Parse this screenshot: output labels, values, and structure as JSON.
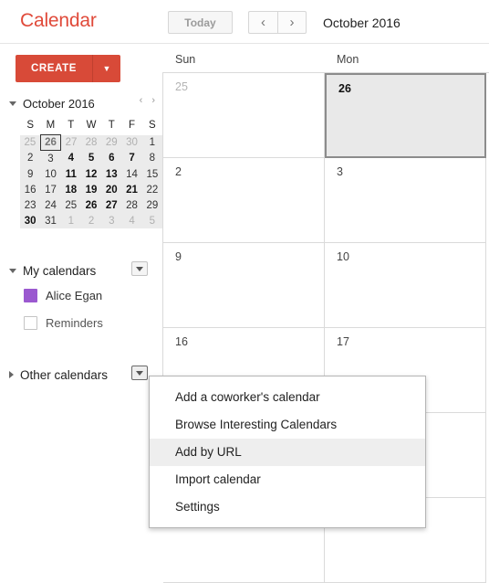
{
  "header": {
    "logo": "Calendar",
    "today_label": "Today",
    "prev_icon": "‹",
    "next_icon": "›",
    "range_title": "October 2016"
  },
  "sidebar": {
    "create_label": "CREATE",
    "create_caret": "▼",
    "mini_calendar": {
      "title": "October 2016",
      "prev_icon": "‹",
      "next_icon": "›",
      "weekdays": [
        "S",
        "M",
        "T",
        "W",
        "T",
        "F",
        "S"
      ],
      "weeks": [
        [
          {
            "d": "25",
            "style": "muted"
          },
          {
            "d": "26",
            "style": "today"
          },
          {
            "d": "27",
            "style": "muted"
          },
          {
            "d": "28",
            "style": "muted"
          },
          {
            "d": "29",
            "style": "muted"
          },
          {
            "d": "30",
            "style": "muted"
          },
          {
            "d": "1",
            "style": "normal"
          }
        ],
        [
          {
            "d": "2",
            "style": "normal"
          },
          {
            "d": "3",
            "style": "normal"
          },
          {
            "d": "4",
            "style": "bold"
          },
          {
            "d": "5",
            "style": "bold"
          },
          {
            "d": "6",
            "style": "bold"
          },
          {
            "d": "7",
            "style": "bold"
          },
          {
            "d": "8",
            "style": "normal"
          }
        ],
        [
          {
            "d": "9",
            "style": "normal"
          },
          {
            "d": "10",
            "style": "normal"
          },
          {
            "d": "11",
            "style": "bold"
          },
          {
            "d": "12",
            "style": "bold"
          },
          {
            "d": "13",
            "style": "bold"
          },
          {
            "d": "14",
            "style": "normal"
          },
          {
            "d": "15",
            "style": "normal"
          }
        ],
        [
          {
            "d": "16",
            "style": "normal"
          },
          {
            "d": "17",
            "style": "normal"
          },
          {
            "d": "18",
            "style": "bold"
          },
          {
            "d": "19",
            "style": "bold"
          },
          {
            "d": "20",
            "style": "bold"
          },
          {
            "d": "21",
            "style": "bold"
          },
          {
            "d": "22",
            "style": "normal"
          }
        ],
        [
          {
            "d": "23",
            "style": "normal"
          },
          {
            "d": "24",
            "style": "normal"
          },
          {
            "d": "25",
            "style": "normal"
          },
          {
            "d": "26",
            "style": "bold"
          },
          {
            "d": "27",
            "style": "bold"
          },
          {
            "d": "28",
            "style": "normal"
          },
          {
            "d": "29",
            "style": "normal"
          }
        ],
        [
          {
            "d": "30",
            "style": "bold"
          },
          {
            "d": "31",
            "style": "normal"
          },
          {
            "d": "1",
            "style": "muted"
          },
          {
            "d": "2",
            "style": "muted"
          },
          {
            "d": "3",
            "style": "muted"
          },
          {
            "d": "4",
            "style": "muted"
          },
          {
            "d": "5",
            "style": "muted"
          }
        ]
      ]
    },
    "my_calendars": {
      "label": "My calendars",
      "expanded": true,
      "items": [
        {
          "name": "Alice Egan",
          "color": "#9b59d0",
          "checked": true
        },
        {
          "name": "Reminders",
          "color": "#ffffff",
          "checked": false
        }
      ]
    },
    "other_calendars": {
      "label": "Other calendars",
      "expanded": false,
      "items": []
    }
  },
  "main": {
    "day_headers": [
      "Sun",
      "Mon"
    ],
    "weeks": [
      [
        {
          "num": "25",
          "muted": true,
          "selected": false
        },
        {
          "num": "26",
          "muted": false,
          "selected": true
        }
      ],
      [
        {
          "num": "2",
          "muted": false,
          "selected": false
        },
        {
          "num": "3",
          "muted": false,
          "selected": false
        }
      ],
      [
        {
          "num": "9",
          "muted": false,
          "selected": false
        },
        {
          "num": "10",
          "muted": false,
          "selected": false
        }
      ],
      [
        {
          "num": "16",
          "muted": false,
          "selected": false
        },
        {
          "num": "17",
          "muted": false,
          "selected": false
        }
      ],
      [
        {
          "num": "",
          "muted": false,
          "selected": false
        },
        {
          "num": "",
          "muted": false,
          "selected": false
        }
      ],
      [
        {
          "num": "",
          "muted": false,
          "selected": false
        },
        {
          "num": "",
          "muted": false,
          "selected": false
        }
      ]
    ]
  },
  "other_calendars_menu": {
    "open": true,
    "items": [
      {
        "label": "Add a coworker's calendar",
        "highlighted": false
      },
      {
        "label": "Browse Interesting Calendars",
        "highlighted": false
      },
      {
        "label": "Add by URL",
        "highlighted": true
      },
      {
        "label": "Import calendar",
        "highlighted": false
      },
      {
        "label": "Settings",
        "highlighted": false
      }
    ]
  },
  "colors": {
    "brand_red": "#e04a3a",
    "create_button": "#d84a38",
    "selected_cell": "#e9e9e9",
    "menu_highlight": "#eeeeee",
    "grid_line": "#dadada",
    "alice_egan": "#9b59d0"
  }
}
